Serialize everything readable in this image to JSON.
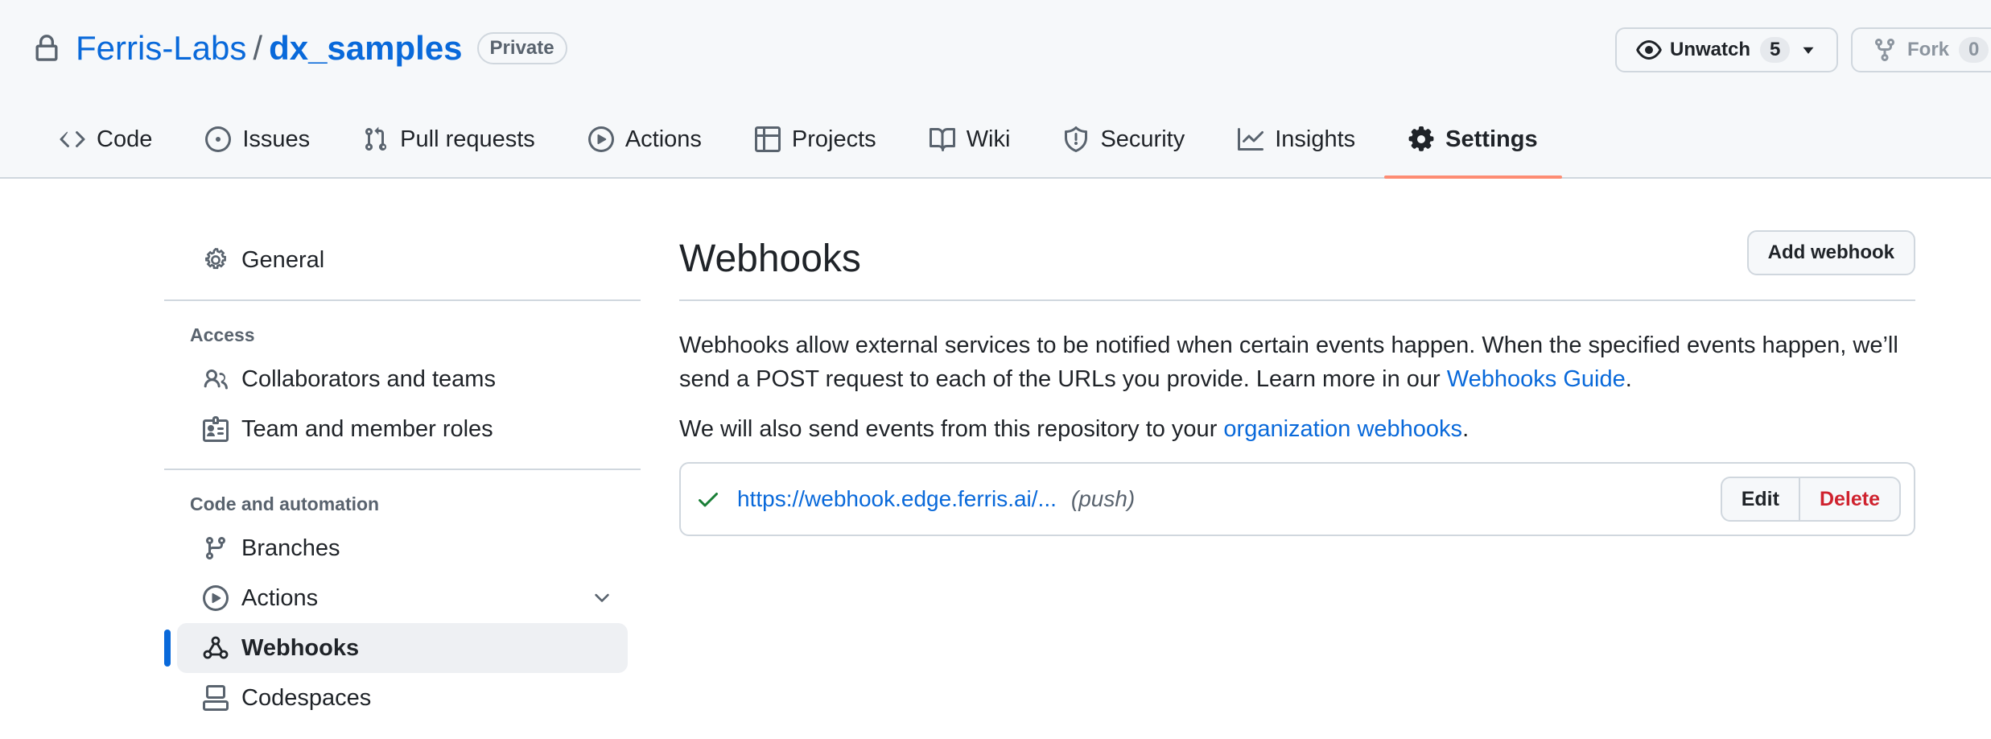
{
  "header": {
    "owner": "Ferris-Labs",
    "separator": "/",
    "repo": "dx_samples",
    "visibility": "Private",
    "unwatch_label": "Unwatch",
    "unwatch_count": "5",
    "fork_label": "Fork",
    "fork_count": "0"
  },
  "nav": {
    "tabs": [
      {
        "label": "Code",
        "icon": "code-icon"
      },
      {
        "label": "Issues",
        "icon": "issue-icon"
      },
      {
        "label": "Pull requests",
        "icon": "pull-request-icon"
      },
      {
        "label": "Actions",
        "icon": "play-icon"
      },
      {
        "label": "Projects",
        "icon": "table-icon"
      },
      {
        "label": "Wiki",
        "icon": "book-icon"
      },
      {
        "label": "Security",
        "icon": "shield-icon"
      },
      {
        "label": "Insights",
        "icon": "graph-icon"
      },
      {
        "label": "Settings",
        "icon": "gear-icon",
        "active": true
      }
    ]
  },
  "sidebar": {
    "general": "General",
    "access_heading": "Access",
    "collaborators": "Collaborators and teams",
    "roles": "Team and member roles",
    "automation_heading": "Code and automation",
    "branches": "Branches",
    "actions": "Actions",
    "webhooks": "Webhooks",
    "codespaces": "Codespaces"
  },
  "main": {
    "title": "Webhooks",
    "add_button": "Add webhook",
    "desc_text": "Webhooks allow external services to be notified when certain events happen. When the specified events happen, we’ll send a POST request to each of the URLs you provide. Learn more in our ",
    "desc_link": "Webhooks Guide",
    "desc_end": ".",
    "org_text": "We will also send events from this repository to your ",
    "org_link": "organization webhooks",
    "org_end": ".",
    "hook": {
      "url": "https://webhook.edge.ferris.ai/...",
      "events": "(push)",
      "status": "success",
      "edit": "Edit",
      "delete": "Delete"
    }
  },
  "colors": {
    "link": "#0969da",
    "active_underline": "#fd8c73",
    "danger": "#cf222e",
    "success": "#1a7f37"
  }
}
